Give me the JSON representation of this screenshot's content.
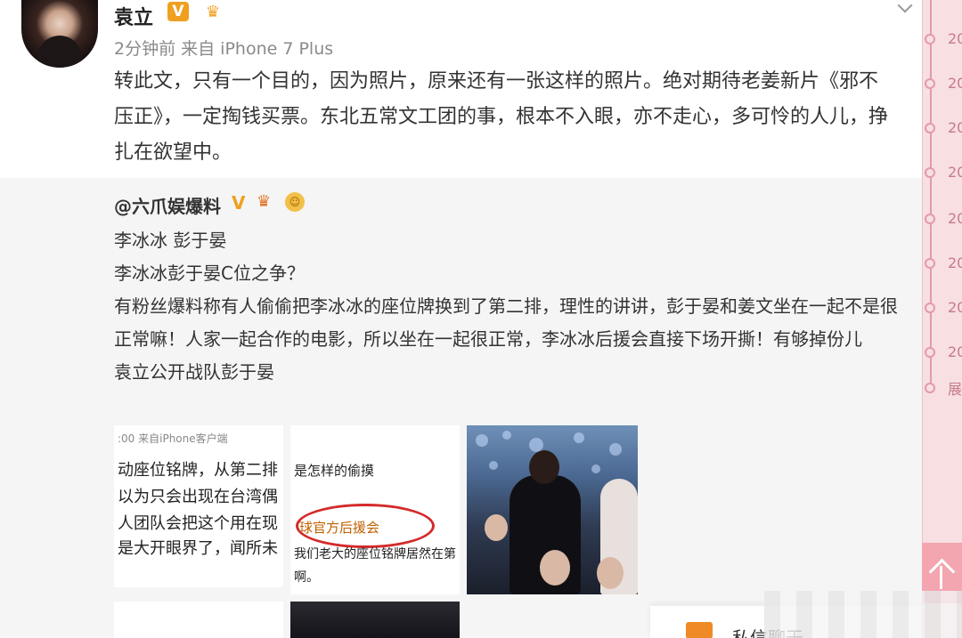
{
  "post": {
    "author": "袁立",
    "verified_badge": "V",
    "meta": "2分钟前 来自 iPhone 7 Plus",
    "text": "转此文，只有一个目的，因为照片，原来还有一张这样的照片。绝对期待老姜新片《邪不压正》，一定掏钱买票。东北五常文工团的事，根本不入眼，亦不走心，多可怜的人儿，挣扎在欲望中。"
  },
  "repost": {
    "author": "@六爪娱爆料",
    "verified_badge": "V",
    "lines": [
      "李冰冰 彭于晏",
      "李冰冰彭于晏C位之争？",
      "有粉丝爆料称有人偷偷把李冰冰的座位牌换到了第二排，理性的讲讲，彭于晏和姜文坐在一起不是很正常嘛！人家一起合作的电影，所以坐在一起很正常，李冰冰后援会直接下场开撕！有够掉份儿",
      "袁立公开战队彭于晏"
    ],
    "thumbs": {
      "t1": {
        "line1": ":00 来自iPhone客户端",
        "line2": "动座位铭牌，从第二排",
        "line3": "以为只会出现在台湾偶",
        "line4": "人团队会把这个用在现",
        "line5": "是大开眼界了，闻所未"
      },
      "t2": {
        "line1": "是怎样的偷摸",
        "line2": "球官方后援会",
        "line3": "我们老大的座位铭牌居然在第",
        "line4": "啊。"
      }
    }
  },
  "sidebar": {
    "years": [
      "20",
      "20",
      "20",
      "20",
      "20",
      "20",
      "20",
      "20",
      "20"
    ],
    "more_label": "展"
  },
  "chat": {
    "label": "私信聊天"
  }
}
